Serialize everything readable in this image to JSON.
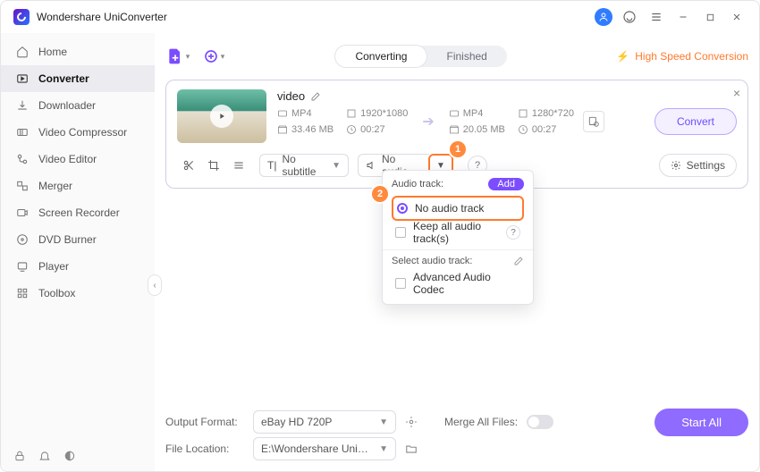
{
  "app": {
    "title": "Wondershare UniConverter"
  },
  "sidebar": {
    "items": [
      {
        "label": "Home"
      },
      {
        "label": "Converter"
      },
      {
        "label": "Downloader"
      },
      {
        "label": "Video Compressor"
      },
      {
        "label": "Video Editor"
      },
      {
        "label": "Merger"
      },
      {
        "label": "Screen Recorder"
      },
      {
        "label": "DVD Burner"
      },
      {
        "label": "Player"
      },
      {
        "label": "Toolbox"
      }
    ]
  },
  "toolbar": {
    "tabs": {
      "converting": "Converting",
      "finished": "Finished"
    },
    "hsc": "High Speed Conversion"
  },
  "video": {
    "name": "video",
    "src": {
      "fmt": "MP4",
      "res": "1920*1080",
      "size": "33.46 MB",
      "dur": "00:27"
    },
    "dst": {
      "fmt": "MP4",
      "res": "1280*720",
      "size": "20.05 MB",
      "dur": "00:27"
    },
    "convert": "Convert",
    "subtitle": "No subtitle",
    "audio": "No audio",
    "settings": "Settings"
  },
  "popup": {
    "hdr": "Audio track:",
    "add": "Add",
    "no_track": "No audio track",
    "keep_all": "Keep all audio track(s)",
    "select": "Select audio track:",
    "advanced": "Advanced Audio Codec"
  },
  "footer": {
    "of_lbl": "Output Format:",
    "of_val": "eBay HD 720P",
    "fl_lbl": "File Location:",
    "fl_val": "E:\\Wondershare UniConverter",
    "merge_lbl": "Merge All Files:",
    "start": "Start All"
  },
  "badges": {
    "one": "1",
    "two": "2"
  }
}
